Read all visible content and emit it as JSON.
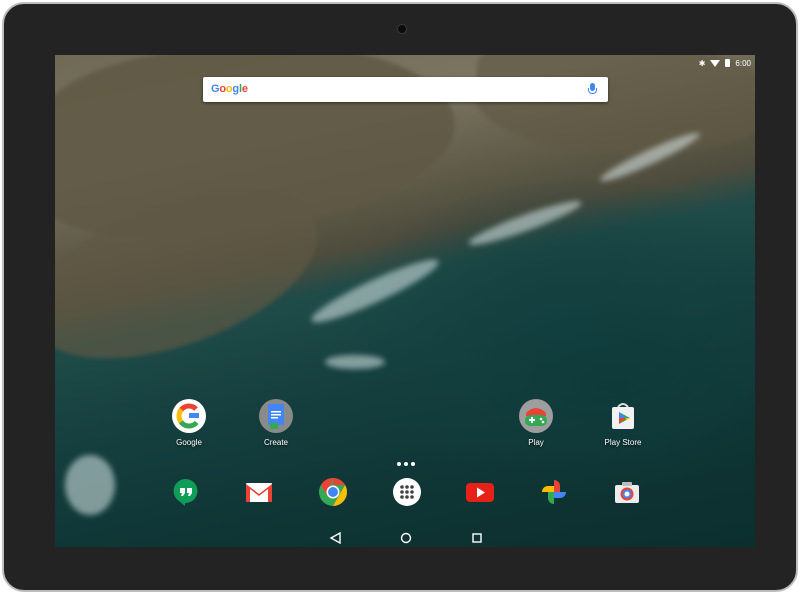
{
  "status_bar": {
    "time": "6:00",
    "bluetooth_icon": "bluetooth-icon",
    "wifi_icon": "wifi-icon",
    "battery_icon": "battery-icon"
  },
  "search": {
    "logo_text": "Google",
    "mic_icon": "microphone-icon"
  },
  "home_apps": [
    {
      "label": "Google",
      "icon": "google-app-icon"
    },
    {
      "label": "Create",
      "icon": "create-folder-icon"
    },
    {
      "label": "Play",
      "icon": "play-games-icon"
    },
    {
      "label": "Play Store",
      "icon": "play-store-icon"
    }
  ],
  "dock": [
    {
      "icon": "hangouts-icon"
    },
    {
      "icon": "gmail-icon"
    },
    {
      "icon": "chrome-icon"
    },
    {
      "icon": "app-drawer-icon"
    },
    {
      "icon": "youtube-icon"
    },
    {
      "icon": "photos-icon"
    },
    {
      "icon": "camera-icon"
    }
  ],
  "navigation": {
    "back": "back-icon",
    "home": "home-icon",
    "recents": "recents-icon"
  },
  "colors": {
    "google_blue": "#4285f4",
    "google_red": "#ea4335",
    "google_yellow": "#fbbc05",
    "google_green": "#34a853",
    "sea": "#15403f"
  }
}
